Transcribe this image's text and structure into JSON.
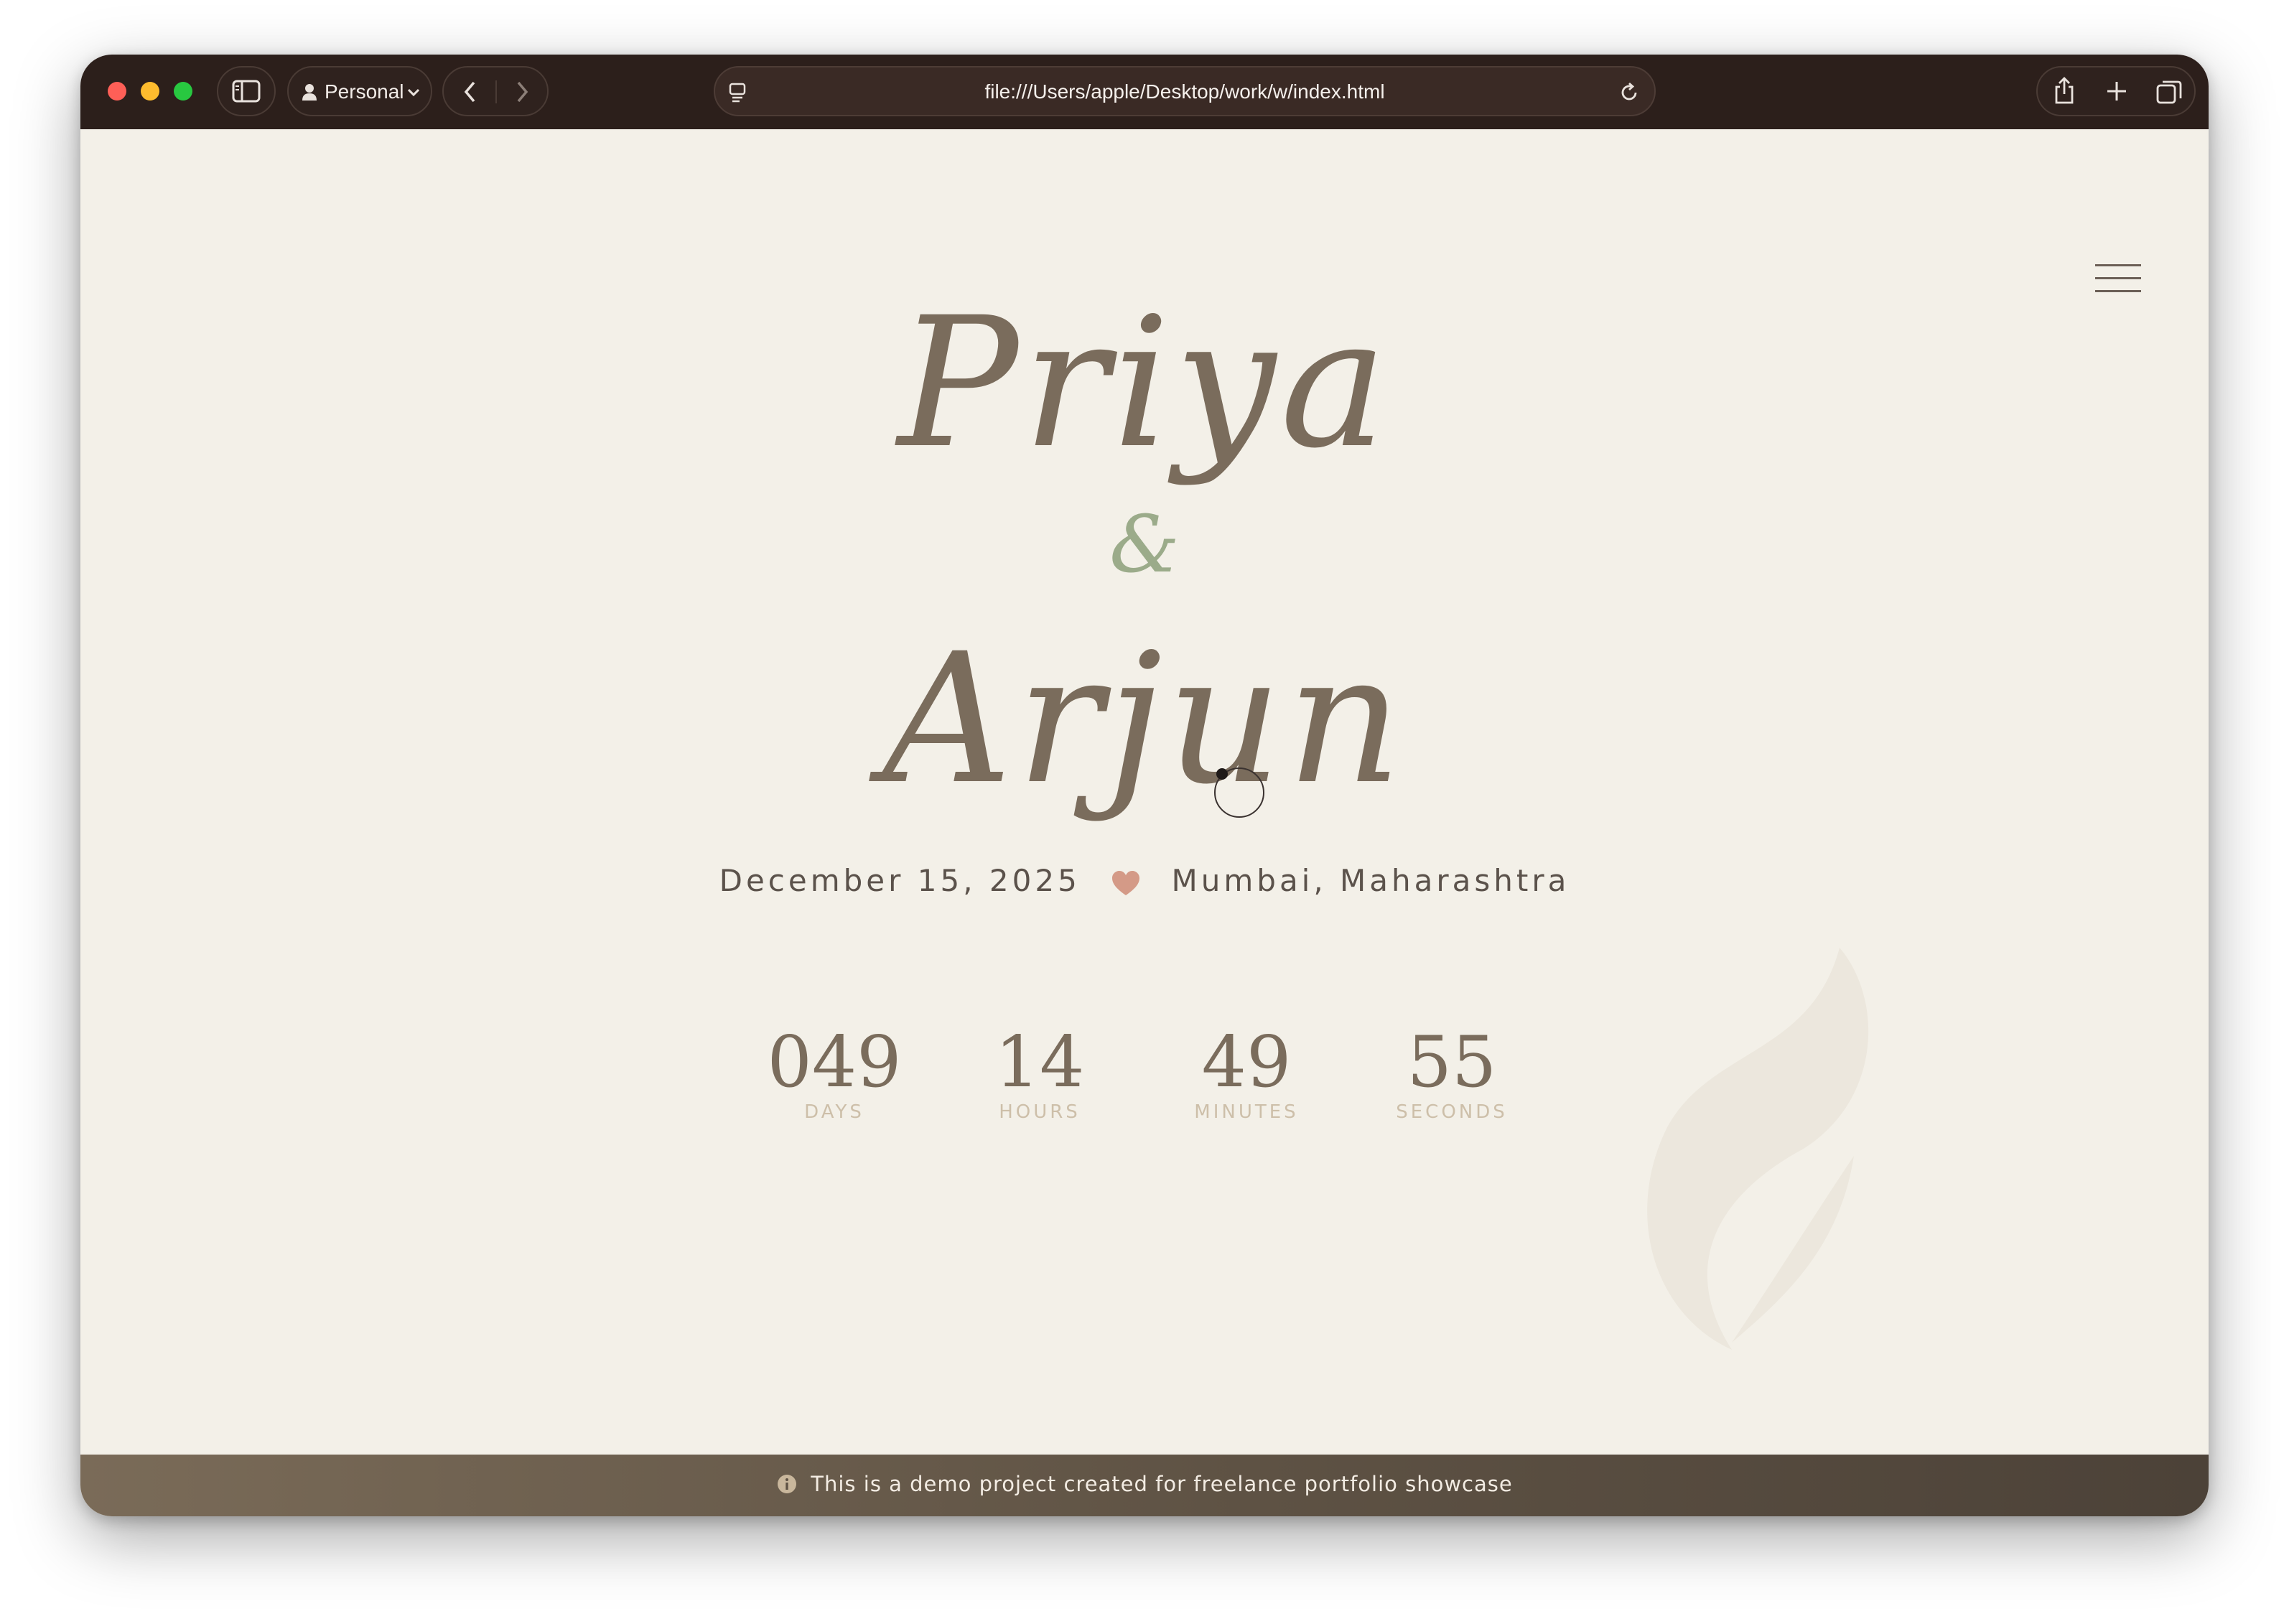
{
  "browser": {
    "profile_label": "Personal",
    "url": "file:///Users/apple/Desktop/work/w/index.html"
  },
  "hero": {
    "name_one": "Priya",
    "ampersand": "&",
    "name_two": "Arjun",
    "date": "December 15, 2025",
    "location": "Mumbai, Maharashtra"
  },
  "countdown": [
    {
      "value": "049",
      "label": "DAYS"
    },
    {
      "value": "14",
      "label": "HOURS"
    },
    {
      "value": "49",
      "label": "MINUTES"
    },
    {
      "value": "55",
      "label": "SECONDS"
    }
  ],
  "footer": {
    "notice": "This is a demo project created for freelance portfolio showcase"
  },
  "colors": {
    "toolbar": "#2c1f1b",
    "page_background": "#f3f0e8",
    "name_text": "#7a6c5c",
    "ampersand": "#9bab8a",
    "heart": "#d49a87",
    "countdown_label": "#cdbfa9",
    "footer": "#5e5244"
  },
  "icons": [
    "sidebar-icon",
    "person-icon",
    "chevron-down-icon",
    "back-icon",
    "forward-icon",
    "reader-icon",
    "reload-icon",
    "share-icon",
    "plus-icon",
    "tabs-icon",
    "hamburger-menu-icon",
    "heart-icon",
    "info-icon",
    "leaf-icon"
  ]
}
